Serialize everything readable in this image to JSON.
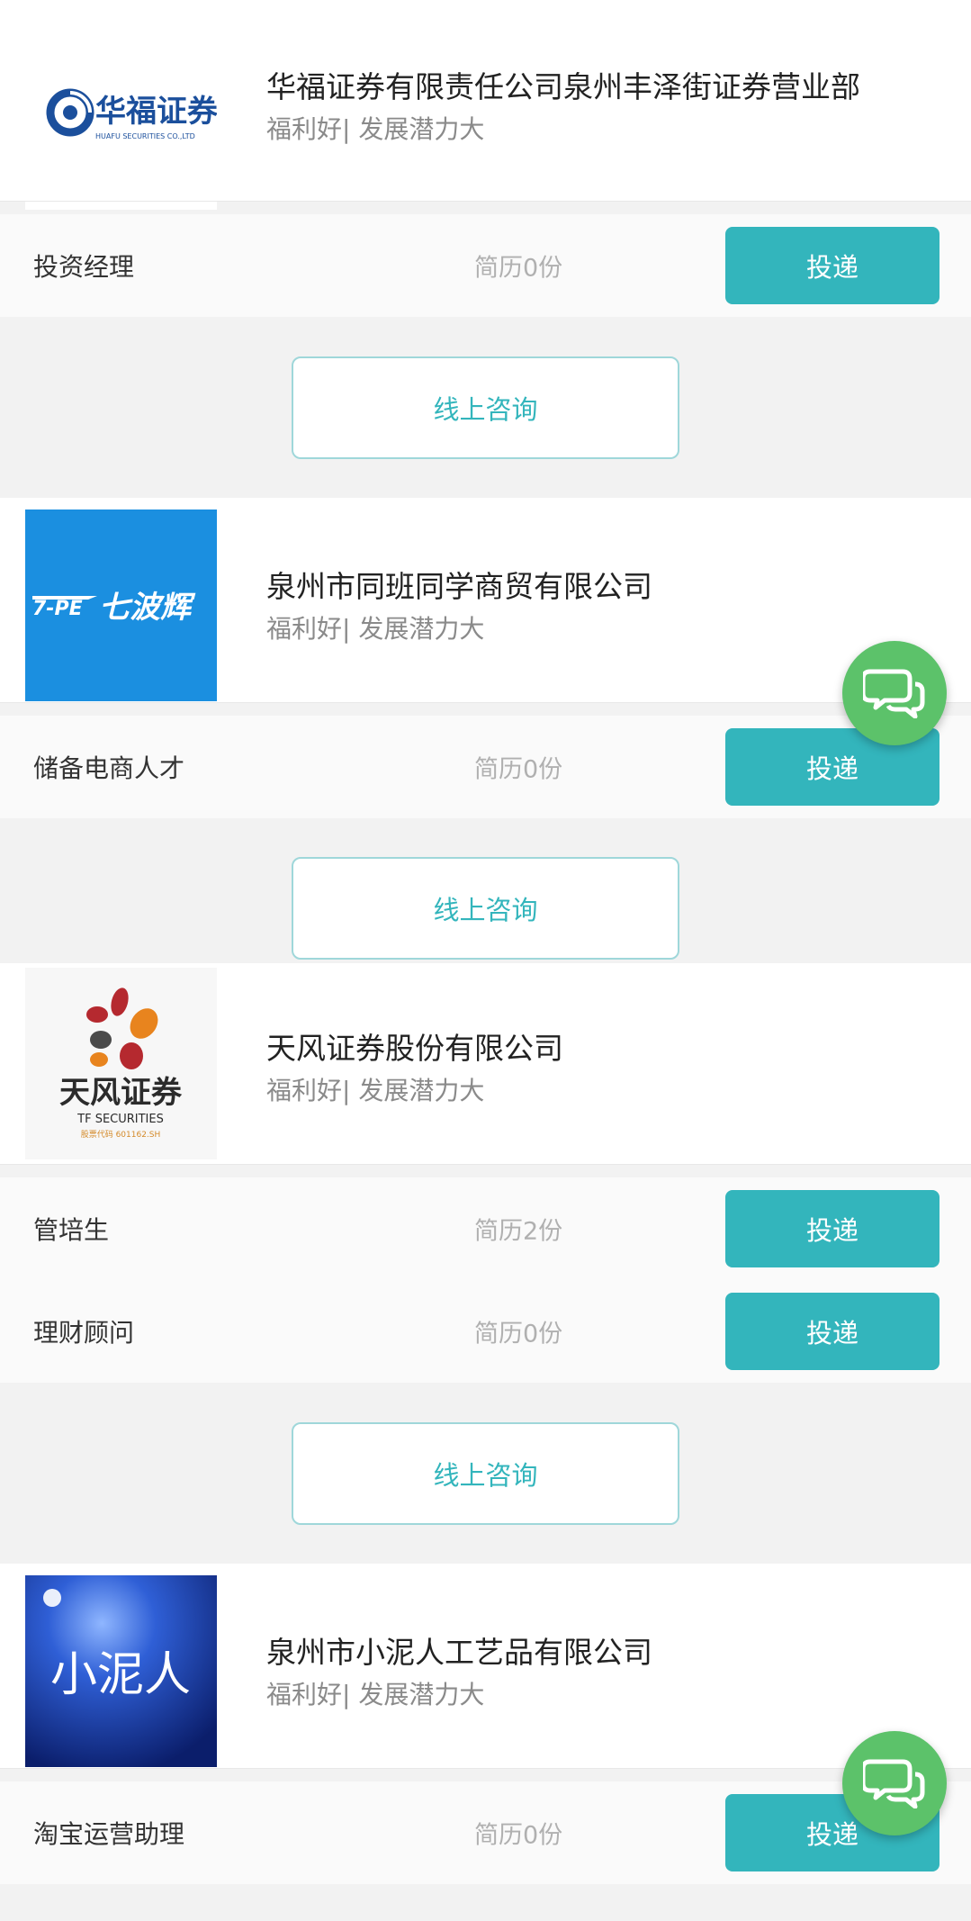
{
  "companies": [
    {
      "name": "华福证券有限责任公司泉州丰泽街证券营业部",
      "tags": "福利好| 发展潜力大",
      "logo_text": "华福证券",
      "logo_subtext": "HUAFU SECURITIES CO.,LTD",
      "jobs": [
        {
          "title": "投资经理",
          "resumes": "简历0份",
          "apply_label": "投递"
        }
      ],
      "consult_label": "线上咨询"
    },
    {
      "name": "泉州市同班同学商贸有限公司",
      "tags": "福利好| 发展潜力大",
      "logo_text": "七波辉",
      "logo_prefix": "7-PE",
      "jobs": [
        {
          "title": "储备电商人才",
          "resumes": "简历0份",
          "apply_label": "投递"
        }
      ],
      "consult_label": "线上咨询"
    },
    {
      "name": "天风证券股份有限公司",
      "tags": "福利好| 发展潜力大",
      "logo_text": "天风证券",
      "logo_subtext": "TF SECURITIES",
      "logo_code": "股票代码 601162.SH",
      "jobs": [
        {
          "title": "管培生",
          "resumes": "简历2份",
          "apply_label": "投递"
        },
        {
          "title": "理财顾问",
          "resumes": "简历0份",
          "apply_label": "投递"
        }
      ],
      "consult_label": "线上咨询"
    },
    {
      "name": "泉州市小泥人工艺品有限公司",
      "tags": "福利好| 发展潜力大",
      "logo_text": "小泥人",
      "jobs": [
        {
          "title": "淘宝运营助理",
          "resumes": "简历0份",
          "apply_label": "投递"
        }
      ]
    }
  ],
  "colors": {
    "accent": "#33b5bc",
    "fab": "#5cc26a",
    "background": "#f2f2f2"
  },
  "icons": {
    "chat_fab": "chat-bubbles-icon"
  }
}
